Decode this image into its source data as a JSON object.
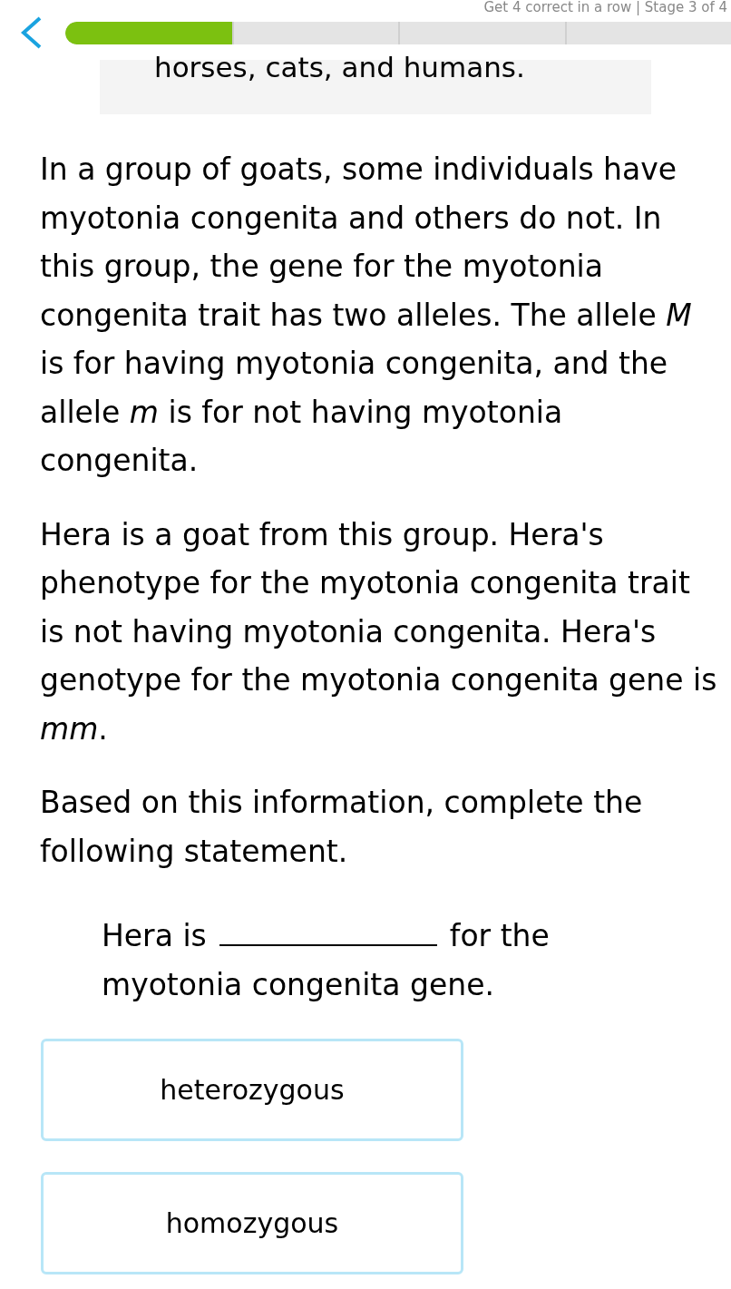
{
  "header": {
    "stage_text": "Get 4 correct in a row | Stage 3 of 4",
    "progress": {
      "level": 0.25
    }
  },
  "context_box": {
    "text": "horses, cats, and humans."
  },
  "paragraphs": [
    "In a group of goats, some individuals have myotonia congenita and others do not. In this group, the gene for the myotonia congenita trait has two alleles. The allele *M* is for having myotonia congenita, and the allele *m* is for not having myotonia congenita.",
    "Hera is a goat from this group. Hera's phenotype for the myotonia congenita trait is not having myotonia congenita. Hera's genotype for the myotonia congenita gene is *mm*.",
    "Based on this information, complete the following statement."
  ],
  "statement": {
    "before": "Hera is",
    "after": "for the",
    "continuation": "myotonia congenita gene."
  },
  "options": [
    {
      "label": "heterozygous",
      "selected": false
    },
    {
      "label": "homozygous",
      "selected": false
    }
  ]
}
